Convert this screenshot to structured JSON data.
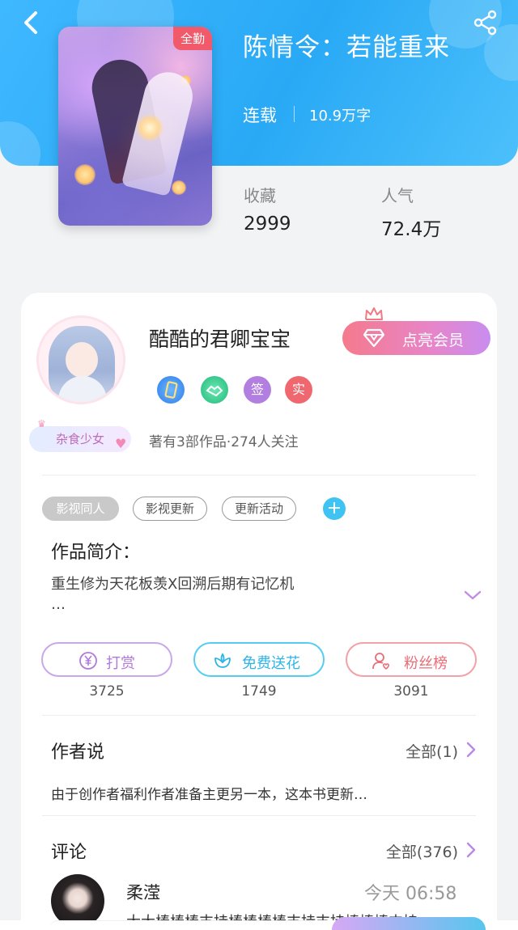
{
  "header": {
    "title": "陈情令：若能重来",
    "status": "连载",
    "word_count": "10.9万字",
    "cover_badge": "全勤",
    "accent_color": "#29a9f5"
  },
  "stats": [
    {
      "label": "收藏",
      "value": "2999"
    },
    {
      "label": "人气",
      "value": "72.4万"
    }
  ],
  "author": {
    "name": "酷酷的君卿宝宝",
    "tag": "杂食少女",
    "vip_button": "点亮会员",
    "badges": [
      {
        "icon": "phone-badge-icon",
        "text": "",
        "color": "#3b8df0"
      },
      {
        "icon": "handshake-badge-icon",
        "text": "",
        "color": "#32c98b"
      },
      {
        "icon": "signed-badge-icon",
        "text": "签",
        "color": "#b27fe0"
      },
      {
        "icon": "verified-badge-icon",
        "text": "实",
        "color": "#f0686f"
      }
    ],
    "summary": "著有3部作品·274人关注"
  },
  "tags": {
    "items": [
      "影视同人",
      "影视更新",
      "更新活动"
    ],
    "add_label": "+"
  },
  "synopsis": {
    "title": "作品简介：",
    "text": "重生修为天花板羡X回溯后期有记忆机",
    "ellipsis": "…"
  },
  "actions": [
    {
      "icon": "yen-coin-icon",
      "label": "打赏",
      "count": "3725",
      "color": "#c08ee6"
    },
    {
      "icon": "flower-icon",
      "label": "免费送花",
      "count": "1749",
      "color": "#3ec3f2"
    },
    {
      "icon": "fan-user-icon",
      "label": "粉丝榜",
      "count": "3091",
      "color": "#f07a82"
    }
  ],
  "authors_note": {
    "title": "作者说",
    "more": "全部(1)",
    "text": "由于创作者福利作者准备主更另一本，这本书更新…"
  },
  "comments": {
    "title": "评论",
    "more": "全部(376)",
    "items": [
      {
        "name": "柔滢",
        "time": "今天 06:58",
        "text": "大大棒棒棒支持棒棒棒棒支持支持棒棒棒支持"
      }
    ]
  }
}
